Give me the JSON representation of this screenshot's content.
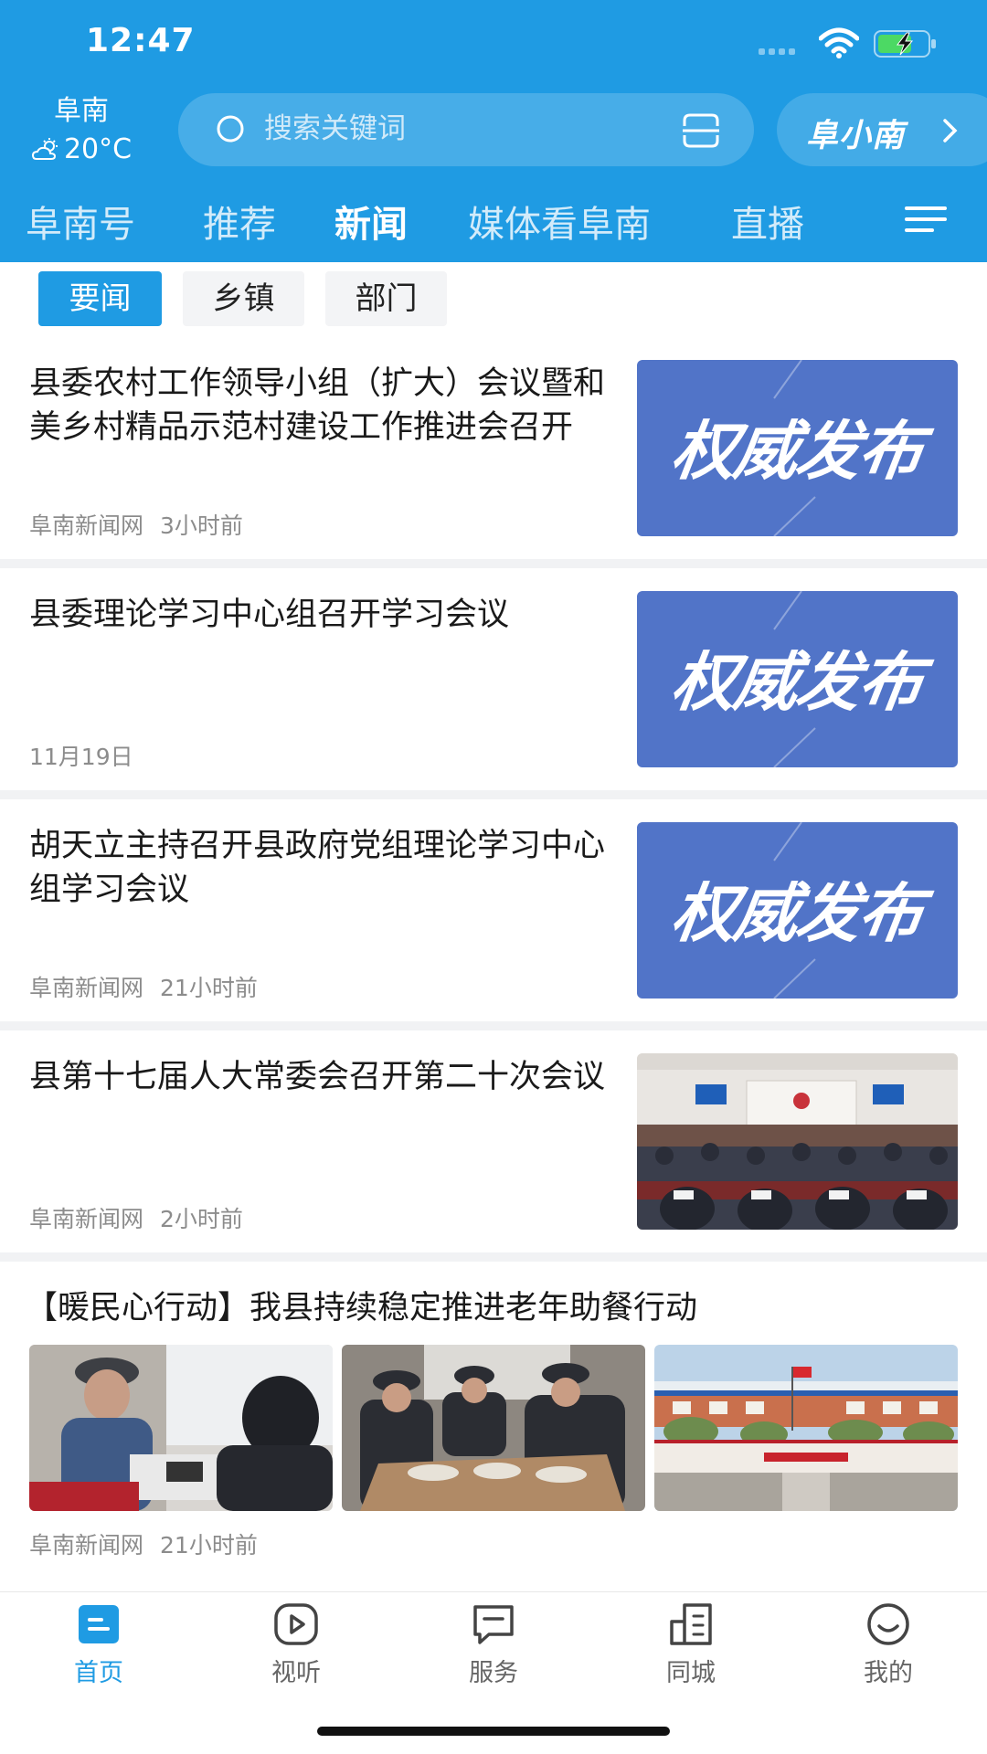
{
  "status_bar": {
    "time": "12:47"
  },
  "header": {
    "city": "阜南",
    "temperature": "20°C",
    "weather_icon": "cloudy-sun-icon",
    "search_placeholder": "搜索关键词",
    "assistant_label": "阜小南"
  },
  "channels": [
    "阜南号",
    "推荐",
    "新闻",
    "媒体看阜南",
    "直播"
  ],
  "active_channel": "新闻",
  "subtabs": [
    "要闻",
    "乡镇",
    "部门"
  ],
  "active_subtab": "要闻",
  "news": [
    {
      "title": "县委农村工作领导小组（扩大）会议暨和美乡村精品示范村建设工作推进会召开",
      "source": "阜南新闻网",
      "time": "3小时前",
      "image_text": "权威发布"
    },
    {
      "title": "县委理论学习中心组召开学习会议",
      "source": "",
      "time": "11月19日",
      "image_text": "权威发布"
    },
    {
      "title": "胡天立主持召开县政府党组理论学习中心组学习会议",
      "source": "阜南新闻网",
      "time": "21小时前",
      "image_text": "权威发布"
    },
    {
      "title": "县第十七届人大常委会召开第二十次会议",
      "source": "阜南新闻网",
      "time": "2小时前",
      "image_text": ""
    }
  ],
  "feature": {
    "title": "【暖民心行动】我县持续稳定推进老年助餐行动",
    "source": "阜南新闻网",
    "time": "21小时前"
  },
  "bottom_nav": [
    {
      "label": "首页",
      "icon": "home-icon"
    },
    {
      "label": "视听",
      "icon": "play-icon"
    },
    {
      "label": "服务",
      "icon": "service-icon"
    },
    {
      "label": "同城",
      "icon": "city-icon"
    },
    {
      "label": "我的",
      "icon": "smile-icon"
    }
  ],
  "colors": {
    "brand": "#1f9be3",
    "promo_bg": "#5174c8",
    "meta_text": "#8c8c8c"
  }
}
